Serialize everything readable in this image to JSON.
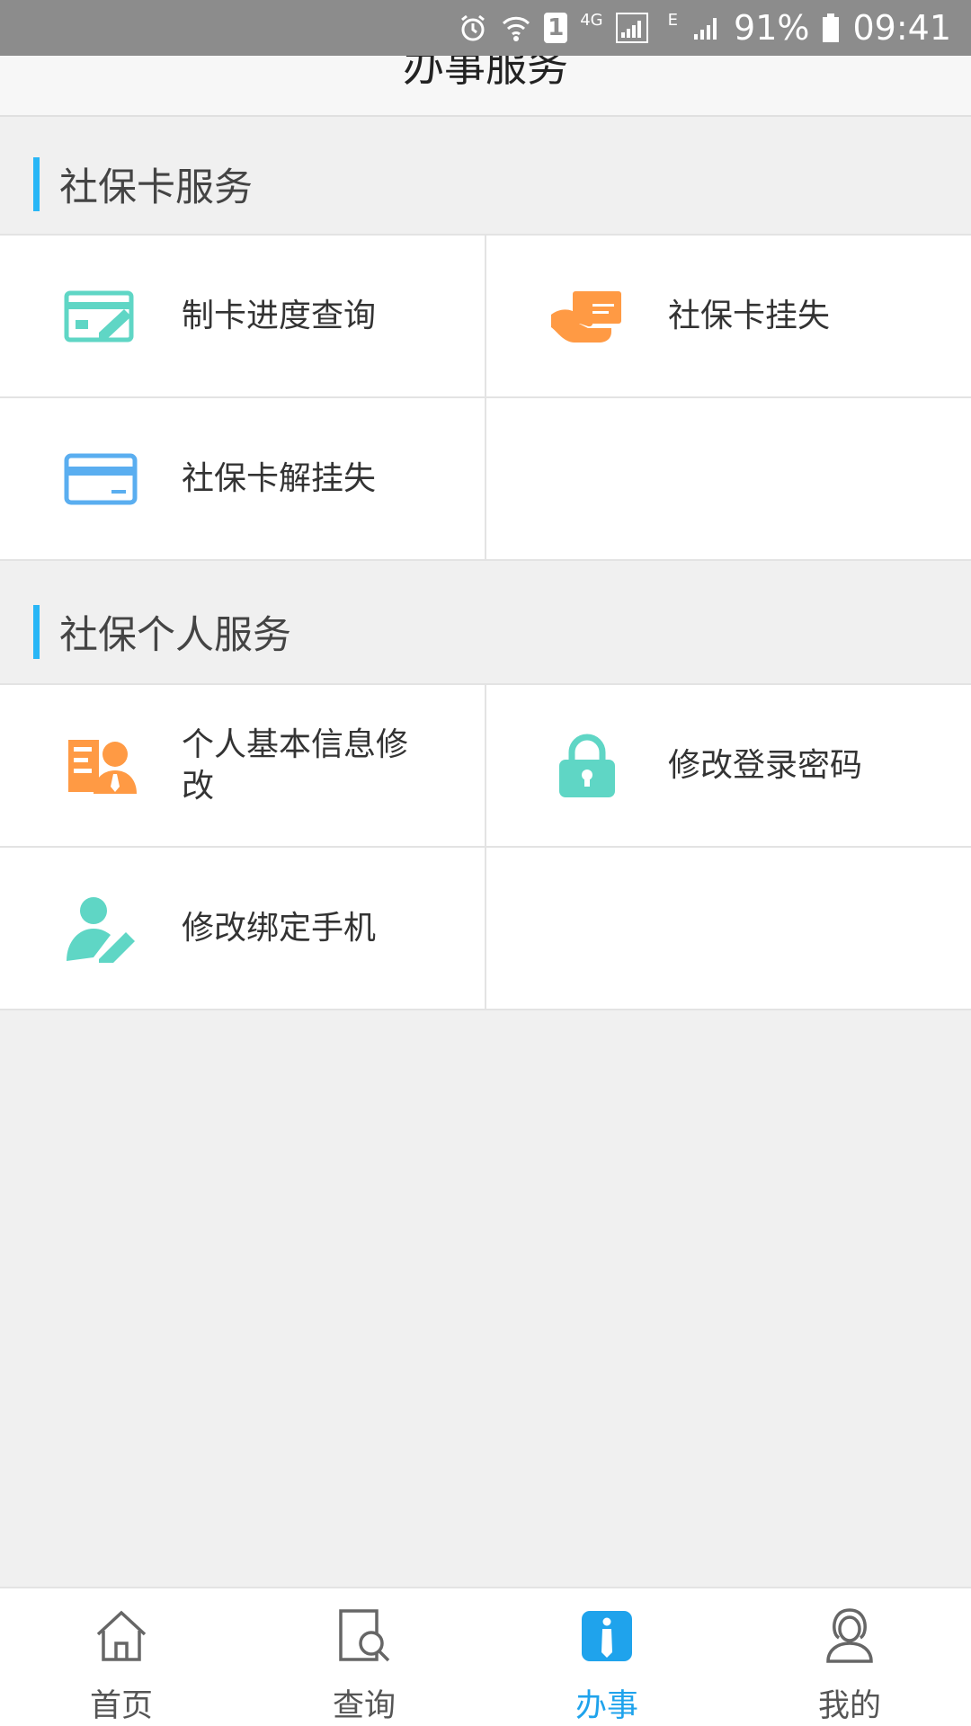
{
  "status_bar": {
    "sim_slot": "1",
    "network_4g": "4G",
    "network_e": "E",
    "battery": "91%",
    "time": "09:41"
  },
  "header": {
    "title": "办事服务"
  },
  "sections": [
    {
      "title": "社保卡服务",
      "items": [
        {
          "label": "制卡进度查询",
          "icon": "card-edit-icon",
          "color": "#5fd6c5"
        },
        {
          "label": "社保卡挂失",
          "icon": "hand-card-icon",
          "color": "#ff9a44"
        },
        {
          "label": "社保卡解挂失",
          "icon": "credit-card-icon",
          "color": "#5aaef0"
        }
      ]
    },
    {
      "title": "社保个人服务",
      "items": [
        {
          "label": "个人基本信息修改",
          "icon": "profile-info-icon",
          "color": "#ff9a44"
        },
        {
          "label": "修改登录密码",
          "icon": "lock-icon",
          "color": "#5fd6c5"
        },
        {
          "label": "修改绑定手机",
          "icon": "user-edit-icon",
          "color": "#5fd6c5"
        }
      ]
    }
  ],
  "tabbar": {
    "tabs": [
      {
        "label": "首页",
        "icon": "home-icon"
      },
      {
        "label": "查询",
        "icon": "search-doc-icon"
      },
      {
        "label": "办事",
        "icon": "info-icon",
        "active": true
      },
      {
        "label": "我的",
        "icon": "user-icon"
      }
    ]
  },
  "accent_color": "#1fa3ec"
}
